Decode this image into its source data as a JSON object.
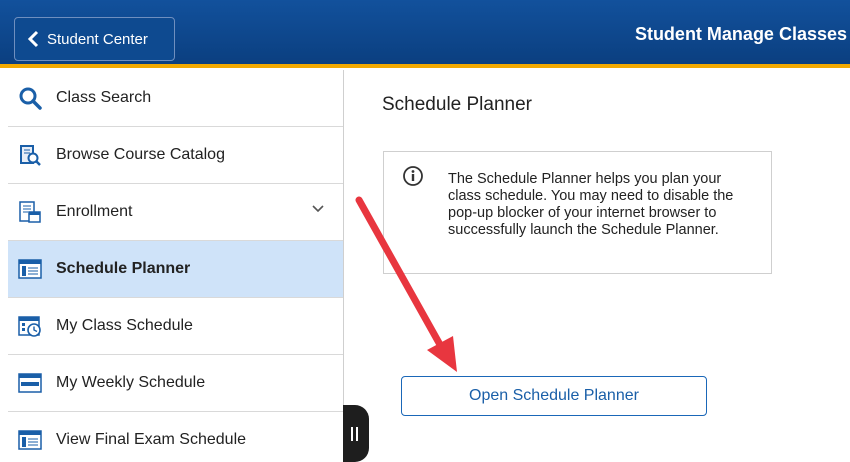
{
  "header": {
    "back_label": "Student Center",
    "title": "Student Manage Classes"
  },
  "sidebar": {
    "items": [
      {
        "label": "Class Search",
        "icon": "search-icon"
      },
      {
        "label": "Browse Course Catalog",
        "icon": "catalog-icon"
      },
      {
        "label": "Enrollment",
        "icon": "enrollment-icon",
        "expandable": true
      },
      {
        "label": "Schedule Planner",
        "icon": "planner-icon",
        "active": true
      },
      {
        "label": "My Class Schedule",
        "icon": "class-schedule-icon"
      },
      {
        "label": "My Weekly Schedule",
        "icon": "weekly-schedule-icon"
      },
      {
        "label": "View Final Exam Schedule",
        "icon": "exam-schedule-icon"
      }
    ]
  },
  "main": {
    "title": "Schedule Planner",
    "info_text": "The Schedule Planner helps you plan your class schedule.  You may need to disable the pop-up blocker of your internet browser to successfully launch the Schedule Planner.",
    "open_button_label": "Open Schedule Planner"
  },
  "colors": {
    "header_bg": "#0b3f80",
    "header_accent": "#f2a900",
    "active_item_bg": "#cfe3f9",
    "button_text": "#1a5fa8",
    "annotation_arrow": "#e8363f"
  }
}
